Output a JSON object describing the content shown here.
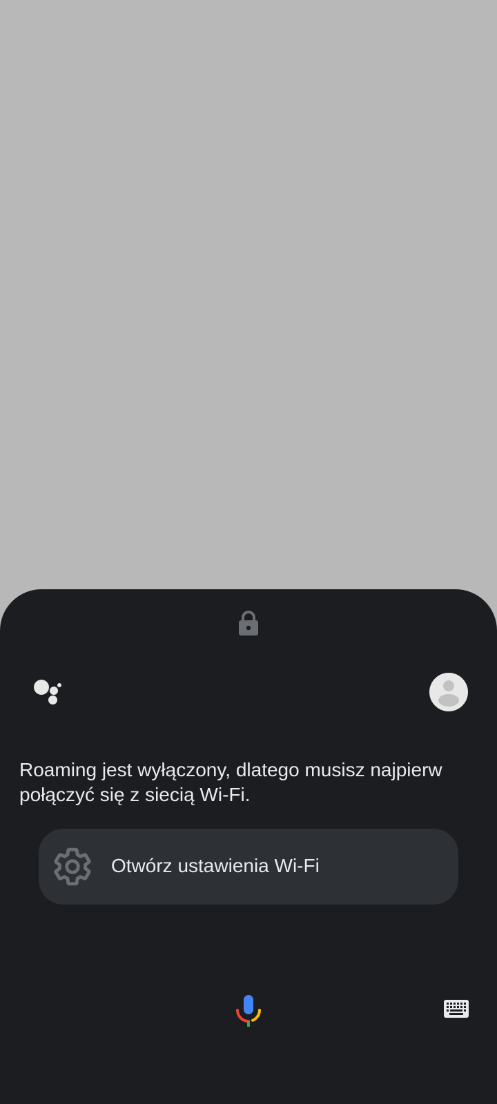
{
  "assistant": {
    "response_text": "Roaming jest wyłączony, dlatego musisz najpierw połączyć się z siecią Wi-Fi.",
    "suggestion_chip_label": "Otwórz ustawienia Wi-Fi"
  },
  "icons": {
    "lock": "lock-icon",
    "logo": "google-assistant-logo",
    "avatar": "account-avatar",
    "settings": "gear-icon",
    "mic": "microphone-icon",
    "keyboard": "keyboard-icon"
  },
  "colors": {
    "scrim": "#b8b8b8",
    "sheet_background": "#1b1d20",
    "chip_background": "#2d3034",
    "text": "#e8eaed",
    "mic_blue": "#4285f4",
    "mic_red": "#ea4335",
    "mic_yellow": "#fbbc04",
    "mic_green": "#34a853"
  }
}
